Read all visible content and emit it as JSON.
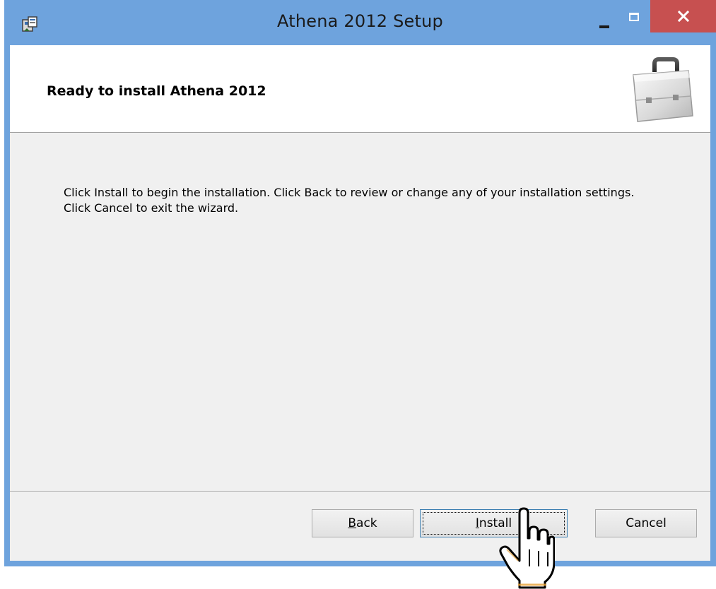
{
  "window": {
    "title": "Athena 2012 Setup",
    "controls": {
      "minimize_icon": "minimize-icon",
      "maximize_icon": "maximize-icon",
      "close_icon": "close-icon"
    },
    "title_bar_color": "#6ea3dd",
    "close_color": "#c75050"
  },
  "banner": {
    "title": "Ready to install Athena 2012",
    "icon": "briefcase-icon"
  },
  "body": {
    "description": "Click Install to begin the installation. Click Back to review or change any of your installation settings. Click Cancel to exit the wizard."
  },
  "buttons": {
    "back": {
      "mnemonic": "B",
      "rest": "ack"
    },
    "install": {
      "mnemonic": "I",
      "rest": "nstall"
    },
    "cancel": "Cancel"
  },
  "cursor": "hand-pointer-icon"
}
